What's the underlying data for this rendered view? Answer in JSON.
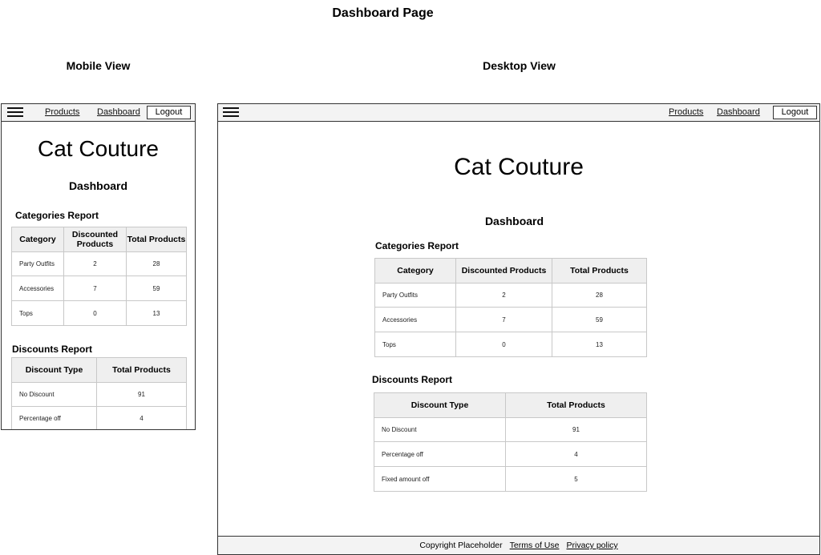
{
  "page_title": "Dashboard Page",
  "mobile_label": "Mobile View",
  "desktop_label": "Desktop View",
  "nav": {
    "products": "Products",
    "dashboard": "Dashboard",
    "logout": "Logout"
  },
  "brand": "Cat Couture",
  "dashboard_heading": "Dashboard",
  "categories_report": {
    "heading": "Categories Report",
    "headers": [
      "Category",
      "Discounted Products",
      "Total Products"
    ],
    "mobile_headers": [
      "Category",
      "Discounted\nProducts",
      "Total\nProducts"
    ],
    "rows": [
      [
        "Party Outfits",
        "2",
        "28"
      ],
      [
        "Accessories",
        "7",
        "59"
      ],
      [
        "Tops",
        "0",
        "13"
      ]
    ]
  },
  "discounts_report": {
    "heading": "Discounts Report",
    "headers": [
      "Discount Type",
      "Total Products"
    ],
    "rows": [
      [
        "No Discount",
        "91"
      ],
      [
        "Percentage off",
        "4"
      ],
      [
        "Fixed amount off",
        "5"
      ]
    ]
  },
  "footer": {
    "copyright": "Copyright Placeholder",
    "terms": "Terms of Use",
    "privacy": "Privacy policy"
  }
}
